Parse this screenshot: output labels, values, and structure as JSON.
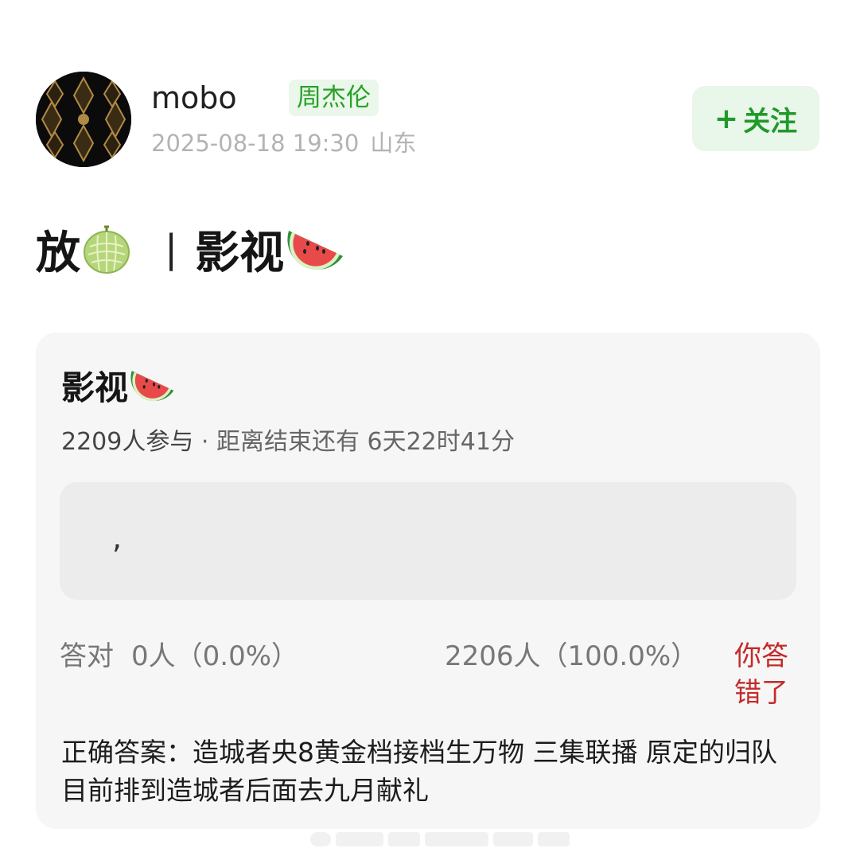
{
  "post": {
    "username": "mobo",
    "user_tag": "周杰伦",
    "timestamp": "2025-08-18 19:30",
    "location": "山东",
    "follow_label": "关注",
    "title_text_1": "放",
    "title_separator": "|",
    "title_text_2": "影视",
    "icons": {
      "avatar": "black-gold-pattern",
      "title_emoji_1": "melon",
      "title_emoji_2": "watermelon"
    }
  },
  "quiz": {
    "title": "影视",
    "participants": "2209人参与",
    "countdown": " · 距离结束还有 6天22时41分",
    "option_text": ",",
    "correct_label": "答对",
    "correct_stat": "0人（0.0%）",
    "other_stat": "2206人（100.0%）",
    "result": "你答错了",
    "answer": "正确答案：造城者央8黄金档接档生万物 三集联播 原定的归队目前排到造城者后面去九月献礼"
  },
  "colors": {
    "follow_text": "#1f9a2a",
    "follow_bg": "#e9f6ea",
    "tag_text": "#27a127",
    "wrong_text": "#c42a2a",
    "card_bg": "#f6f6f6"
  }
}
